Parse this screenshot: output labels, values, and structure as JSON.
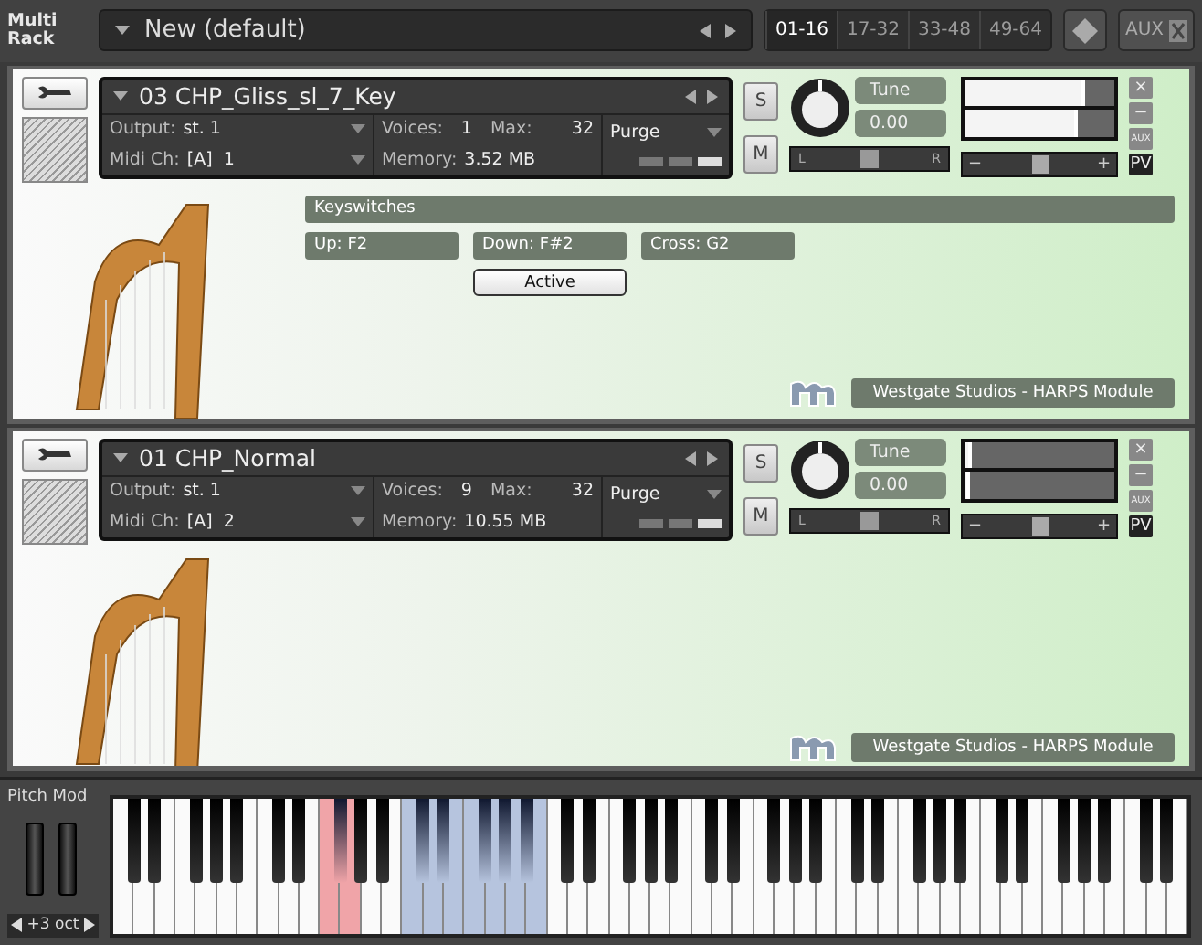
{
  "top_bar": {
    "rack_label": "Multi Rack",
    "preset": "New (default)",
    "pages": [
      {
        "label": "01-16",
        "selected": true
      },
      {
        "label": "17-32",
        "selected": false
      },
      {
        "label": "33-48",
        "selected": false
      },
      {
        "label": "49-64",
        "selected": false
      }
    ],
    "aux": "AUX"
  },
  "instruments": [
    {
      "name": "03 CHP_Gliss_sl_7_Key",
      "output_label": "Output:",
      "output": "st. 1",
      "midi_label": "Midi Ch:",
      "midi": "[A]  1",
      "voices_label": "Voices:",
      "voices": "1",
      "max_label": "Max:",
      "max": "32",
      "memory_label": "Memory:",
      "memory": "3.52 MB",
      "purge": "Purge",
      "solo": "S",
      "mute": "M",
      "tune_label": "Tune",
      "tune_value": "0.00",
      "pan_left": "L",
      "pan_right": "R",
      "pan": {
        "level": 0.5
      },
      "meters": [
        {
          "level": 0.8
        },
        {
          "level": 0.75
        }
      ],
      "volume": {
        "level": 0.5
      },
      "volume_min": "−",
      "volume_max": "+",
      "side": [
        "×",
        "−",
        "AUX",
        "PV"
      ],
      "keyswitches": {
        "title": "Keyswitches",
        "fields": [
          "Up: F2",
          "Down: F#2",
          "Cross: G2"
        ],
        "button": "Active"
      },
      "vendor": "Westgate Studios - HARPS Module"
    },
    {
      "name": "01 CHP_Normal",
      "output_label": "Output:",
      "output": "st. 1",
      "midi_label": "Midi Ch:",
      "midi": "[A]  2",
      "voices_label": "Voices:",
      "voices": "9",
      "max_label": "Max:",
      "max": "32",
      "memory_label": "Memory:",
      "memory": "10.55 MB",
      "purge": "Purge",
      "solo": "S",
      "mute": "M",
      "tune_label": "Tune",
      "tune_value": "0.00",
      "pan_left": "L",
      "pan_right": "R",
      "pan": {
        "level": 0.5
      },
      "meters": [
        {
          "level": 0.05
        },
        {
          "level": 0.04
        }
      ],
      "volume": {
        "level": 0.5
      },
      "volume_min": "−",
      "volume_max": "+",
      "side": [
        "×",
        "−",
        "AUX",
        "PV"
      ],
      "vendor": "Westgate Studios - HARPS Module"
    }
  ],
  "keyboard": {
    "label": "Pitch Mod",
    "octave": "+3 oct",
    "zones": [
      {
        "kind": "keyswitch",
        "color": "#f0a4a8"
      },
      {
        "kind": "mapped",
        "color": "#b6c4de"
      }
    ]
  }
}
